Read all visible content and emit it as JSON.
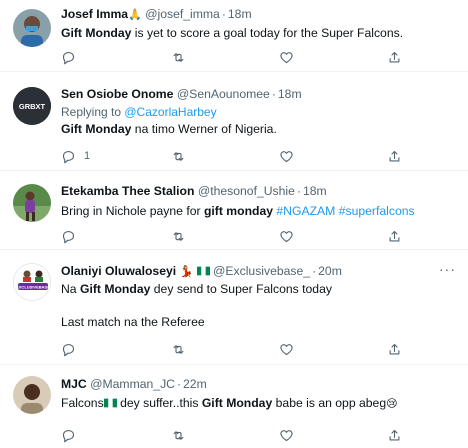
{
  "tweets": [
    {
      "name": "Josef Imma",
      "name_emoji": "🙏",
      "handle": "@josef_imma",
      "time": "18m",
      "text_bold": "Gift Monday",
      "text_rest": " is yet to score a goal today for the Super Falcons."
    },
    {
      "name": "Sen Osiobe Onome",
      "handle": "@SenAounomee",
      "time": "18m",
      "avatar_text": "GRBXT",
      "reply_prefix": "Replying to ",
      "reply_to": "@CazorlaHarbey",
      "text_bold": "Gift Monday",
      "text_rest": " na timo Werner of Nigeria.",
      "reply_count": "1"
    },
    {
      "name": "Etekamba Thee Stalion",
      "handle": "@thesonof_Ushie",
      "time": "18m",
      "text_pre": "Bring in Nichole payne for ",
      "text_bold": "gift monday",
      "tag1": "#NGAZAM",
      "tag2": "#superfalcons"
    },
    {
      "name": "Olaniyi Oluwaloseyi",
      "name_emoji": "💃",
      "handle": "@Exclusivebase_",
      "time": "20m",
      "avatar_text": "EXCLUSIVEBASE",
      "text_pre": "Na ",
      "text_bold": "Gift Monday",
      "text_rest": " dey send to Super Falcons today",
      "text_line2": "Last match na the Referee",
      "more": "···"
    },
    {
      "name": "MJC",
      "handle": "@Mamman_JC",
      "time": "22m",
      "text_pre": "Falcons",
      "text_mid": " dey suffer..this ",
      "text_bold": "Gift Monday",
      "text_rest": " babe is an opp abeg",
      "end_emoji": "😢"
    }
  ],
  "icons": {
    "reply": "reply-icon",
    "retweet": "retweet-icon",
    "like": "like-icon",
    "share": "share-icon"
  },
  "colors": {
    "link": "#1d9bf0",
    "muted": "#536471",
    "divider": "#eff3f4"
  }
}
